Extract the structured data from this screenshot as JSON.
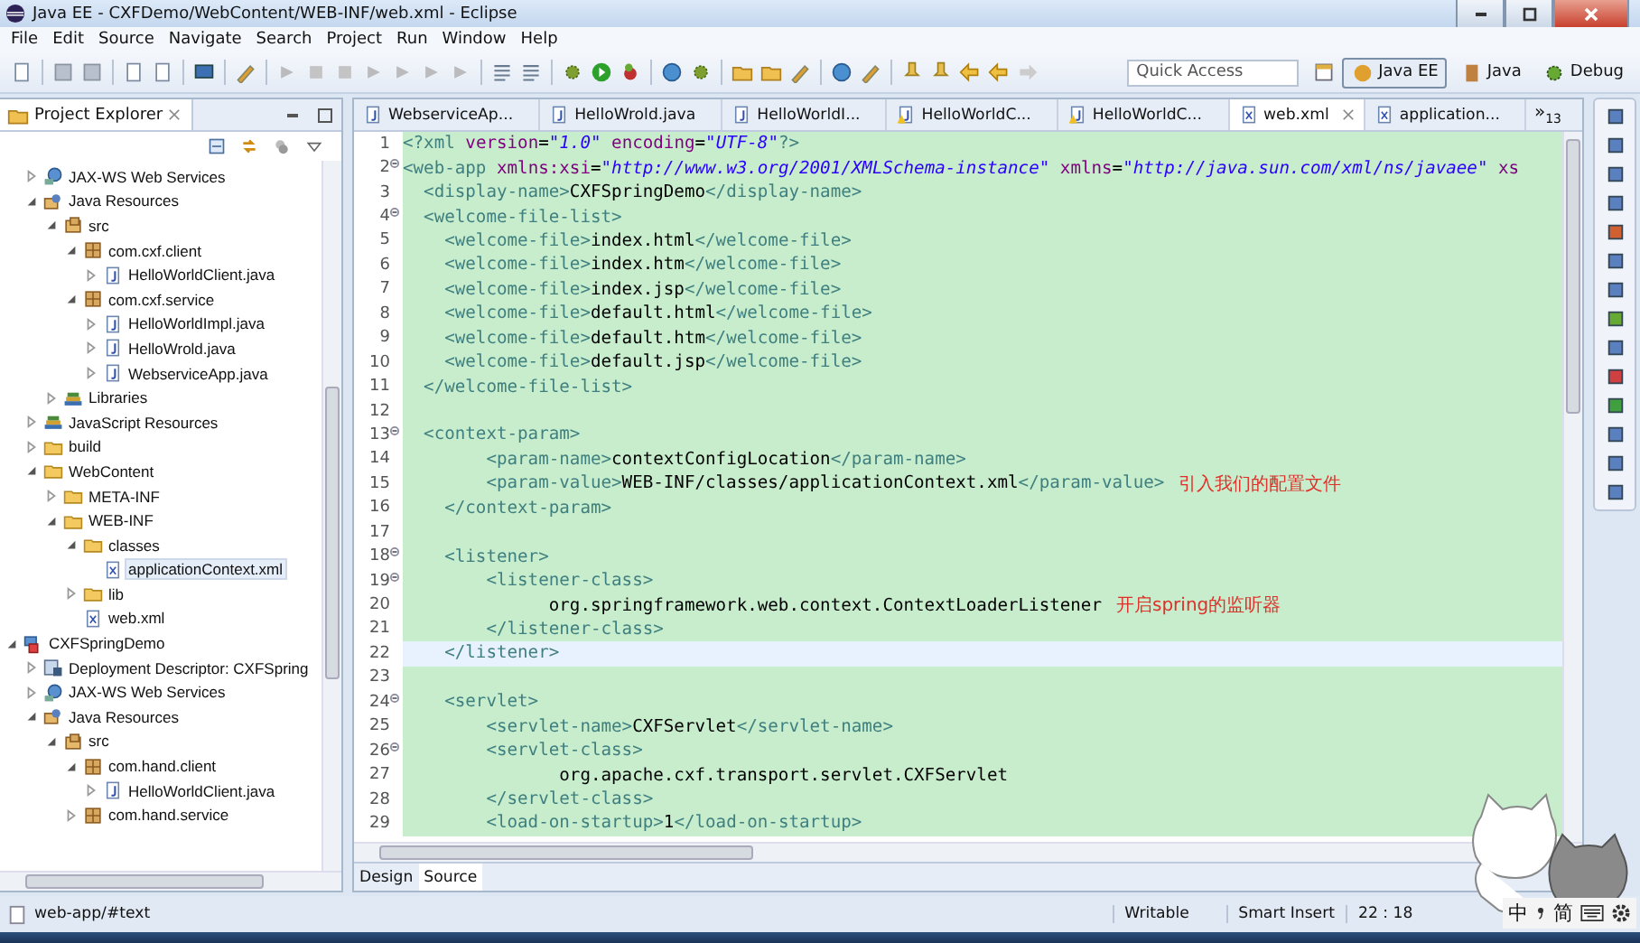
{
  "window": {
    "title": "Java EE - CXFDemo/WebContent/WEB-INF/web.xml - Eclipse"
  },
  "menu": [
    "File",
    "Edit",
    "Source",
    "Navigate",
    "Search",
    "Project",
    "Run",
    "Window",
    "Help"
  ],
  "toolbar": {
    "quick_access": {
      "placeholder": "Quick Access"
    },
    "perspectives": [
      {
        "label": "Java EE",
        "selected": true
      },
      {
        "label": "Java",
        "selected": false
      },
      {
        "label": "Debug",
        "selected": false
      }
    ]
  },
  "project_explorer": {
    "title": "Project Explorer",
    "items": [
      {
        "children": [
          {
            "label": "JAX-WS Web Services",
            "kind": "ws",
            "expanded": false,
            "selected": false
          },
          {
            "label": "Java Resources",
            "kind": "resources",
            "expanded": true,
            "selected": false,
            "children": [
              {
                "label": "src",
                "kind": "src",
                "expanded": true,
                "selected": false,
                "children": [
                  {
                    "label": "com.cxf.client",
                    "kind": "package",
                    "expanded": true,
                    "selected": false,
                    "children": [
                      {
                        "label": "HelloWorldClient.java",
                        "kind": "java",
                        "expanded": false,
                        "selected": false
                      }
                    ]
                  },
                  {
                    "label": "com.cxf.service",
                    "kind": "package",
                    "expanded": true,
                    "selected": false,
                    "children": [
                      {
                        "label": "HelloWorldImpl.java",
                        "kind": "java",
                        "expanded": false,
                        "selected": false
                      },
                      {
                        "label": "HelloWrold.java",
                        "kind": "java",
                        "expanded": false,
                        "selected": false
                      },
                      {
                        "label": "WebserviceApp.java",
                        "kind": "java",
                        "expanded": false,
                        "selected": false
                      }
                    ]
                  }
                ]
              },
              {
                "label": "Libraries",
                "kind": "library",
                "expanded": false,
                "selected": false
              }
            ]
          },
          {
            "label": "JavaScript Resources",
            "kind": "library",
            "expanded": false,
            "selected": false
          },
          {
            "label": "build",
            "kind": "folder",
            "expanded": false,
            "selected": false
          },
          {
            "label": "WebContent",
            "kind": "folder",
            "expanded": true,
            "selected": false,
            "children": [
              {
                "label": "META-INF",
                "kind": "folder",
                "expanded": false,
                "selected": false
              },
              {
                "label": "WEB-INF",
                "kind": "folder",
                "expanded": true,
                "selected": false,
                "children": [
                  {
                    "label": "classes",
                    "kind": "folder",
                    "expanded": true,
                    "selected": false,
                    "children": [
                      {
                        "label": "applicationContext.xml",
                        "kind": "xml",
                        "selected": true
                      }
                    ]
                  },
                  {
                    "label": "lib",
                    "kind": "folder",
                    "expanded": false,
                    "selected": false
                  },
                  {
                    "label": "web.xml",
                    "kind": "xml",
                    "selected": false
                  }
                ]
              }
            ]
          }
        ]
      },
      {
        "label": "CXFSpringDemo",
        "kind": "project",
        "expanded": true,
        "selected": false,
        "children": [
          {
            "label": "Deployment Descriptor: CXFSpring",
            "kind": "descriptor",
            "expanded": false,
            "selected": false
          },
          {
            "label": "JAX-WS Web Services",
            "kind": "ws",
            "expanded": false,
            "selected": false
          },
          {
            "label": "Java Resources",
            "kind": "resources",
            "expanded": true,
            "selected": false,
            "children": [
              {
                "label": "src",
                "kind": "src",
                "expanded": true,
                "selected": false,
                "children": [
                  {
                    "label": "com.hand.client",
                    "kind": "package",
                    "expanded": true,
                    "selected": false,
                    "children": [
                      {
                        "label": "HelloWorldClient.java",
                        "kind": "java",
                        "expanded": false,
                        "selected": false
                      }
                    ]
                  },
                  {
                    "label": "com.hand.service",
                    "kind": "package",
                    "expanded": false,
                    "selected": false
                  }
                ]
              }
            ]
          }
        ]
      }
    ]
  },
  "editor": {
    "tabs": [
      {
        "label": "WebserviceAp...",
        "kind": "java",
        "selected": false
      },
      {
        "label": "HelloWrold.java",
        "kind": "java",
        "selected": false
      },
      {
        "label": "HelloWorldI...",
        "kind": "java",
        "selected": false
      },
      {
        "label": "HelloWorldC...",
        "kind": "java-warning",
        "selected": false
      },
      {
        "label": "HelloWorldC...",
        "kind": "java-warning",
        "selected": false
      },
      {
        "label": "web.xml",
        "kind": "xml",
        "selected": true
      },
      {
        "label": "application...",
        "kind": "xml",
        "selected": false
      }
    ],
    "overflow": {
      "symbol": "»",
      "count": "13"
    },
    "lines": [
      {
        "number": "1",
        "foldable": false,
        "current": false,
        "segments": [
          {
            "kind": "tag",
            "text": "<?xml"
          },
          {
            "kind": "attr",
            "text": " version"
          },
          {
            "kind": "text",
            "text": "="
          },
          {
            "kind": "string",
            "text": "\"1.0\""
          },
          {
            "kind": "attr",
            "text": " encoding"
          },
          {
            "kind": "text",
            "text": "="
          },
          {
            "kind": "string",
            "text": "\"UTF-8\""
          },
          {
            "kind": "tag",
            "text": "?>"
          }
        ]
      },
      {
        "number": "2",
        "foldable": true,
        "current": false,
        "segments": [
          {
            "kind": "tag",
            "text": "<web-app"
          },
          {
            "kind": "attr",
            "text": " xmlns:xsi"
          },
          {
            "kind": "text",
            "text": "="
          },
          {
            "kind": "string",
            "text": "\"http://www.w3.org/2001/XMLSchema-instance\""
          },
          {
            "kind": "attr",
            "text": " xmlns"
          },
          {
            "kind": "text",
            "text": "="
          },
          {
            "kind": "string",
            "text": "\"http://java.sun.com/xml/ns/javaee\""
          },
          {
            "kind": "attr",
            "text": " xs"
          }
        ]
      },
      {
        "number": "3",
        "foldable": false,
        "current": false,
        "segments": [
          {
            "kind": "tag",
            "text": "  <display-name>"
          },
          {
            "kind": "text",
            "text": "CXFSpringDemo"
          },
          {
            "kind": "tag",
            "text": "</display-name>"
          }
        ]
      },
      {
        "number": "4",
        "foldable": true,
        "current": false,
        "segments": [
          {
            "kind": "tag",
            "text": "  <welcome-file-list>"
          }
        ]
      },
      {
        "number": "5",
        "foldable": false,
        "current": false,
        "segments": [
          {
            "kind": "tag",
            "text": "    <welcome-file>"
          },
          {
            "kind": "text",
            "text": "index.html"
          },
          {
            "kind": "tag",
            "text": "</welcome-file>"
          }
        ]
      },
      {
        "number": "6",
        "foldable": false,
        "current": false,
        "segments": [
          {
            "kind": "tag",
            "text": "    <welcome-file>"
          },
          {
            "kind": "text",
            "text": "index.htm"
          },
          {
            "kind": "tag",
            "text": "</welcome-file>"
          }
        ]
      },
      {
        "number": "7",
        "foldable": false,
        "current": false,
        "segments": [
          {
            "kind": "tag",
            "text": "    <welcome-file>"
          },
          {
            "kind": "text",
            "text": "index.jsp"
          },
          {
            "kind": "tag",
            "text": "</welcome-file>"
          }
        ]
      },
      {
        "number": "8",
        "foldable": false,
        "current": false,
        "segments": [
          {
            "kind": "tag",
            "text": "    <welcome-file>"
          },
          {
            "kind": "text",
            "text": "default.html"
          },
          {
            "kind": "tag",
            "text": "</welcome-file>"
          }
        ]
      },
      {
        "number": "9",
        "foldable": false,
        "current": false,
        "segments": [
          {
            "kind": "tag",
            "text": "    <welcome-file>"
          },
          {
            "kind": "text",
            "text": "default.htm"
          },
          {
            "kind": "tag",
            "text": "</welcome-file>"
          }
        ]
      },
      {
        "number": "10",
        "foldable": false,
        "current": false,
        "segments": [
          {
            "kind": "tag",
            "text": "    <welcome-file>"
          },
          {
            "kind": "text",
            "text": "default.jsp"
          },
          {
            "kind": "tag",
            "text": "</welcome-file>"
          }
        ]
      },
      {
        "number": "11",
        "foldable": false,
        "current": false,
        "segments": [
          {
            "kind": "tag",
            "text": "  </welcome-file-list>"
          }
        ]
      },
      {
        "number": "12",
        "foldable": false,
        "current": false
      },
      {
        "number": "13",
        "foldable": true,
        "current": false,
        "segments": [
          {
            "kind": "tag",
            "text": "  <context-param>"
          }
        ]
      },
      {
        "number": "14",
        "foldable": false,
        "current": false,
        "segments": [
          {
            "kind": "tag",
            "text": "        <param-name>"
          },
          {
            "kind": "text",
            "text": "contextConfigLocation"
          },
          {
            "kind": "tag",
            "text": "</param-name>"
          }
        ]
      },
      {
        "number": "15",
        "foldable": false,
        "current": false,
        "segments": [
          {
            "kind": "tag",
            "text": "        <param-value>"
          },
          {
            "kind": "text",
            "text": "WEB-INF/classes/applicationContext.xml"
          },
          {
            "kind": "tag",
            "text": "</param-value>"
          }
        ],
        "note": "引入我们的配置文件"
      },
      {
        "number": "16",
        "foldable": false,
        "current": false,
        "segments": [
          {
            "kind": "tag",
            "text": "    </context-param>"
          }
        ]
      },
      {
        "number": "17",
        "foldable": false,
        "current": false
      },
      {
        "number": "18",
        "foldable": true,
        "current": false,
        "segments": [
          {
            "kind": "tag",
            "text": "    <listener>"
          }
        ]
      },
      {
        "number": "19",
        "foldable": true,
        "current": false,
        "segments": [
          {
            "kind": "tag",
            "text": "        <listener-class>"
          }
        ]
      },
      {
        "number": "20",
        "foldable": false,
        "current": false,
        "segments": [
          {
            "kind": "text",
            "text": "              org.springframework.web.context.ContextLoaderListener"
          }
        ],
        "note": "开启spring的监听器"
      },
      {
        "number": "21",
        "foldable": false,
        "current": false,
        "segments": [
          {
            "kind": "tag",
            "text": "        </listener-class>"
          }
        ]
      },
      {
        "number": "22",
        "foldable": false,
        "current": true,
        "segments": [
          {
            "kind": "tag",
            "text": "    </listener>"
          }
        ]
      },
      {
        "number": "23",
        "foldable": false,
        "current": false
      },
      {
        "number": "24",
        "foldable": true,
        "current": false,
        "segments": [
          {
            "kind": "tag",
            "text": "    <servlet>"
          }
        ]
      },
      {
        "number": "25",
        "foldable": false,
        "current": false,
        "segments": [
          {
            "kind": "tag",
            "text": "        <servlet-name>"
          },
          {
            "kind": "text",
            "text": "CXFServlet"
          },
          {
            "kind": "tag",
            "text": "</servlet-name>"
          }
        ]
      },
      {
        "number": "26",
        "foldable": true,
        "current": false,
        "segments": [
          {
            "kind": "tag",
            "text": "        <servlet-class>"
          }
        ]
      },
      {
        "number": "27",
        "foldable": false,
        "current": false,
        "segments": [
          {
            "kind": "text",
            "text": "               org.apache.cxf.transport.servlet.CXFServlet"
          }
        ]
      },
      {
        "number": "28",
        "foldable": false,
        "current": false,
        "segments": [
          {
            "kind": "tag",
            "text": "        </servlet-class>"
          }
        ]
      },
      {
        "number": "29",
        "foldable": false,
        "current": false,
        "segments": [
          {
            "kind": "tag",
            "text": "        <load-on-startup>"
          },
          {
            "kind": "text",
            "text": "1"
          },
          {
            "kind": "tag",
            "text": "</load-on-startup>"
          }
        ]
      }
    ],
    "bottom_tabs": [
      {
        "label": "Design",
        "selected": false
      },
      {
        "label": "Source",
        "selected": true
      }
    ]
  },
  "status_bar": {
    "path": "web-app/#text",
    "fields": [
      "Writable",
      "Smart Insert",
      "22 : 18"
    ]
  },
  "ime": {
    "mode": "中",
    "script": "简"
  }
}
